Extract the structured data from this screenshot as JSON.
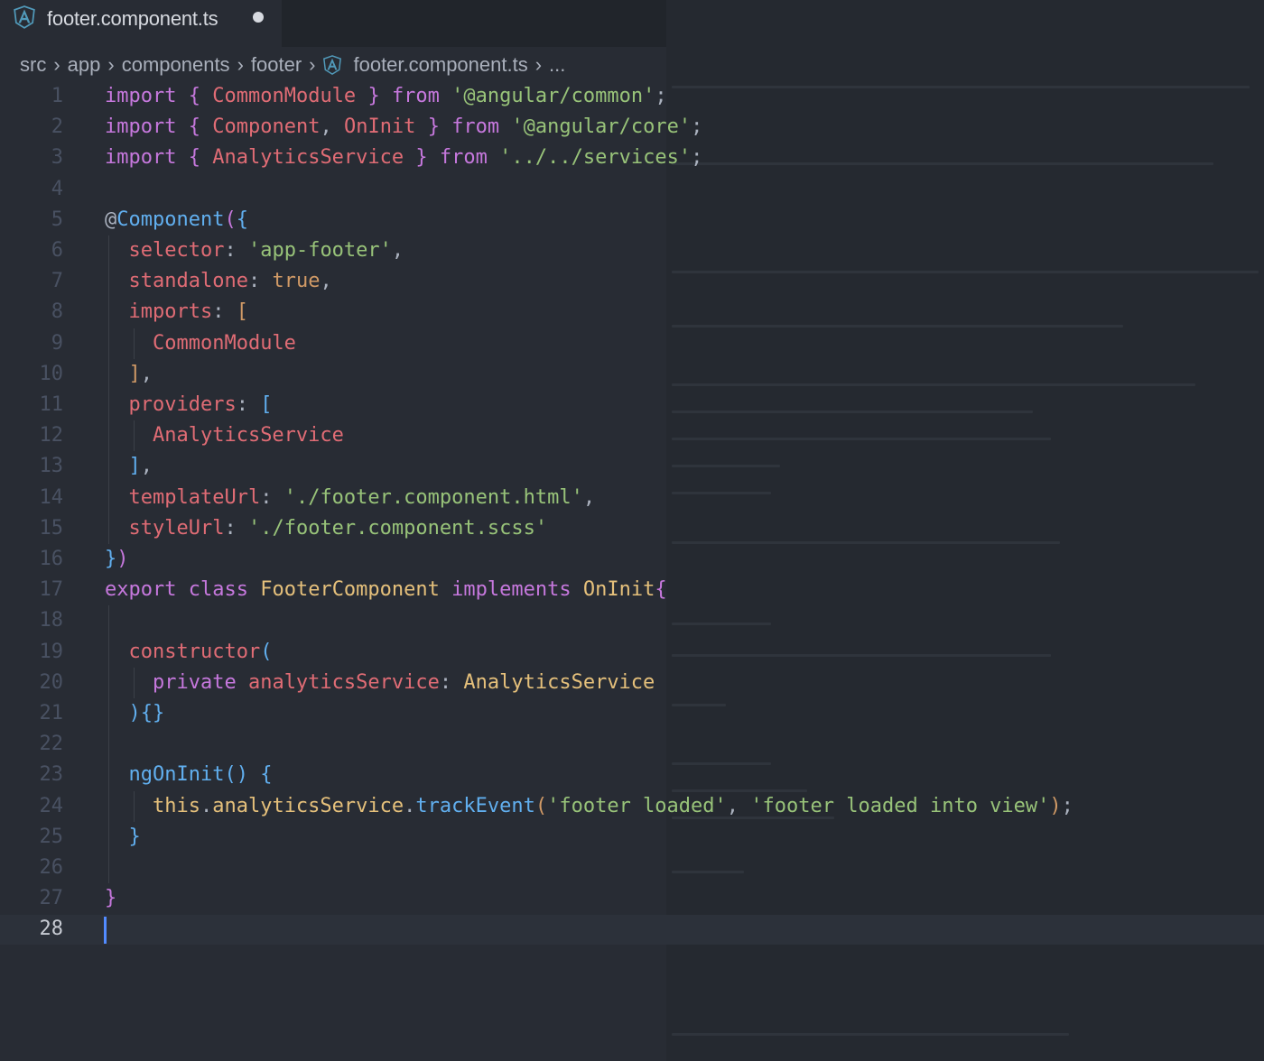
{
  "tab": {
    "title": "footer.component.ts",
    "icon": "angular-icon",
    "modified": true
  },
  "breadcrumbs": [
    "src",
    "app",
    "components",
    "footer",
    "footer.component.ts",
    "..."
  ],
  "editor": {
    "active_line": 28,
    "lines": [
      {
        "n": "1",
        "tokens": [
          [
            "kw",
            "import"
          ],
          [
            "pun",
            " "
          ],
          [
            "br1",
            "{"
          ],
          [
            "pun",
            " "
          ],
          [
            "ident",
            "CommonModule"
          ],
          [
            "pun",
            " "
          ],
          [
            "br1",
            "}"
          ],
          [
            "pun",
            " "
          ],
          [
            "kw",
            "from"
          ],
          [
            "pun",
            " "
          ],
          [
            "str",
            "'@angular/common'"
          ],
          [
            "pun",
            ";"
          ]
        ]
      },
      {
        "n": "2",
        "tokens": [
          [
            "kw",
            "import"
          ],
          [
            "pun",
            " "
          ],
          [
            "br1",
            "{"
          ],
          [
            "pun",
            " "
          ],
          [
            "ident",
            "Component"
          ],
          [
            "pun",
            ", "
          ],
          [
            "ident",
            "OnInit"
          ],
          [
            "pun",
            " "
          ],
          [
            "br1",
            "}"
          ],
          [
            "pun",
            " "
          ],
          [
            "kw",
            "from"
          ],
          [
            "pun",
            " "
          ],
          [
            "str",
            "'@angular/core'"
          ],
          [
            "pun",
            ";"
          ]
        ]
      },
      {
        "n": "3",
        "tokens": [
          [
            "kw",
            "import"
          ],
          [
            "pun",
            " "
          ],
          [
            "br1",
            "{"
          ],
          [
            "pun",
            " "
          ],
          [
            "ident",
            "AnalyticsService"
          ],
          [
            "pun",
            " "
          ],
          [
            "br1",
            "}"
          ],
          [
            "pun",
            " "
          ],
          [
            "kw",
            "from"
          ],
          [
            "pun",
            " "
          ],
          [
            "str",
            "'../../services'"
          ],
          [
            "pun",
            ";"
          ]
        ]
      },
      {
        "n": "4",
        "tokens": []
      },
      {
        "n": "5",
        "tokens": [
          [
            "pun",
            "@"
          ],
          [
            "fn",
            "Component"
          ],
          [
            "br1",
            "("
          ],
          [
            "br2",
            "{"
          ]
        ]
      },
      {
        "n": "6",
        "tokens": [
          [
            "pun",
            "  "
          ],
          [
            "ident",
            "selector"
          ],
          [
            "pun",
            ": "
          ],
          [
            "str",
            "'app-footer'"
          ],
          [
            "pun",
            ","
          ]
        ]
      },
      {
        "n": "7",
        "tokens": [
          [
            "pun",
            "  "
          ],
          [
            "ident",
            "standalone"
          ],
          [
            "pun",
            ": "
          ],
          [
            "yel",
            "true"
          ],
          [
            "pun",
            ","
          ]
        ]
      },
      {
        "n": "8",
        "tokens": [
          [
            "pun",
            "  "
          ],
          [
            "ident",
            "imports"
          ],
          [
            "pun",
            ": "
          ],
          [
            "br3",
            "["
          ]
        ]
      },
      {
        "n": "9",
        "tokens": [
          [
            "pun",
            "    "
          ],
          [
            "ident",
            "CommonModule"
          ]
        ]
      },
      {
        "n": "10",
        "tokens": [
          [
            "pun",
            "  "
          ],
          [
            "br3",
            "]"
          ],
          [
            "pun",
            ","
          ]
        ]
      },
      {
        "n": "11",
        "tokens": [
          [
            "pun",
            "  "
          ],
          [
            "ident",
            "providers"
          ],
          [
            "pun",
            ": "
          ],
          [
            "br2",
            "["
          ]
        ]
      },
      {
        "n": "12",
        "tokens": [
          [
            "pun",
            "    "
          ],
          [
            "ident",
            "AnalyticsService"
          ]
        ]
      },
      {
        "n": "13",
        "tokens": [
          [
            "pun",
            "  "
          ],
          [
            "br2",
            "]"
          ],
          [
            "pun",
            ","
          ]
        ]
      },
      {
        "n": "14",
        "tokens": [
          [
            "pun",
            "  "
          ],
          [
            "ident",
            "templateUrl"
          ],
          [
            "pun",
            ": "
          ],
          [
            "str",
            "'./footer.component.html'"
          ],
          [
            "pun",
            ","
          ]
        ]
      },
      {
        "n": "15",
        "tokens": [
          [
            "pun",
            "  "
          ],
          [
            "ident",
            "styleUrl"
          ],
          [
            "pun",
            ": "
          ],
          [
            "str",
            "'./footer.component.scss'"
          ]
        ]
      },
      {
        "n": "16",
        "tokens": [
          [
            "br2",
            "}"
          ],
          [
            "br1",
            ")"
          ]
        ]
      },
      {
        "n": "17",
        "tokens": [
          [
            "kw",
            "export"
          ],
          [
            "pun",
            " "
          ],
          [
            "kw",
            "class"
          ],
          [
            "pun",
            " "
          ],
          [
            "cls",
            "FooterComponent"
          ],
          [
            "pun",
            " "
          ],
          [
            "kw",
            "implements"
          ],
          [
            "pun",
            " "
          ],
          [
            "cls",
            "OnInit"
          ],
          [
            "br1",
            "{"
          ]
        ]
      },
      {
        "n": "18",
        "tokens": []
      },
      {
        "n": "19",
        "tokens": [
          [
            "pun",
            "  "
          ],
          [
            "ident",
            "constructor"
          ],
          [
            "br2",
            "("
          ]
        ]
      },
      {
        "n": "20",
        "tokens": [
          [
            "pun",
            "    "
          ],
          [
            "kw",
            "private"
          ],
          [
            "pun",
            " "
          ],
          [
            "ident",
            "analyticsService"
          ],
          [
            "pun",
            ": "
          ],
          [
            "cls",
            "AnalyticsService"
          ]
        ]
      },
      {
        "n": "21",
        "tokens": [
          [
            "pun",
            "  "
          ],
          [
            "br2",
            ")"
          ],
          [
            "br2",
            "{}"
          ]
        ]
      },
      {
        "n": "22",
        "tokens": []
      },
      {
        "n": "23",
        "tokens": [
          [
            "pun",
            "  "
          ],
          [
            "fn",
            "ngOnInit"
          ],
          [
            "br2",
            "()"
          ],
          [
            "pun",
            " "
          ],
          [
            "br2",
            "{"
          ]
        ]
      },
      {
        "n": "24",
        "tokens": [
          [
            "pun",
            "    "
          ],
          [
            "plain",
            "this"
          ],
          [
            "pun",
            "."
          ],
          [
            "plain",
            "analyticsService"
          ],
          [
            "pun",
            "."
          ],
          [
            "fn",
            "trackEvent"
          ],
          [
            "br3",
            "("
          ],
          [
            "str",
            "'footer loaded'"
          ],
          [
            "pun",
            ", "
          ],
          [
            "str",
            "'footer loaded into view'"
          ],
          [
            "br3",
            ")"
          ],
          [
            "pun",
            ";"
          ]
        ]
      },
      {
        "n": "25",
        "tokens": [
          [
            "pun",
            "  "
          ],
          [
            "br2",
            "}"
          ]
        ]
      },
      {
        "n": "26",
        "tokens": []
      },
      {
        "n": "27",
        "tokens": [
          [
            "br1",
            "}"
          ]
        ]
      },
      {
        "n": "28",
        "tokens": []
      }
    ]
  }
}
